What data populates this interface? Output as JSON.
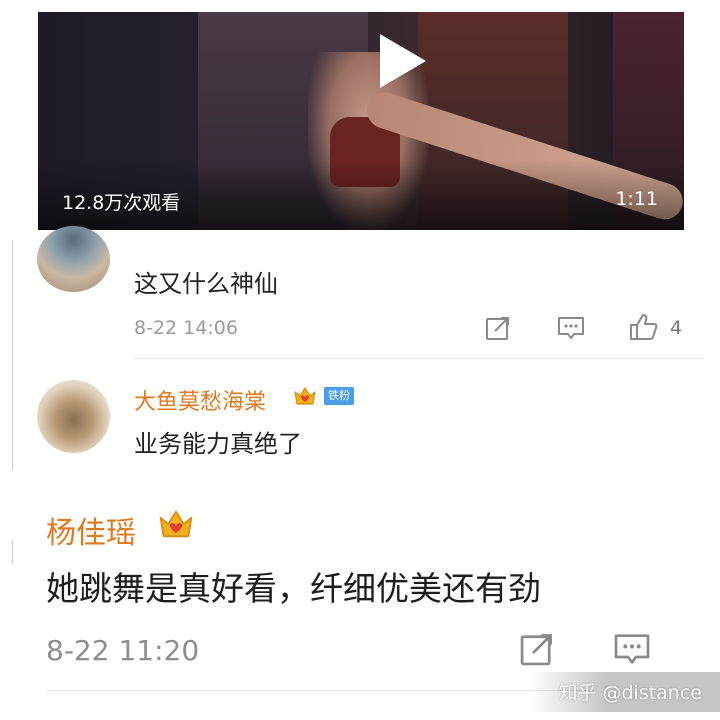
{
  "video": {
    "views": "12.8万次观看",
    "duration": "1:11"
  },
  "comments": [
    {
      "text": "这又什么神仙",
      "time": "8-22 14:06",
      "likes": "4"
    },
    {
      "name": "大鱼莫愁海棠",
      "tag": "铁粉",
      "text": "业务能力真绝了"
    },
    {
      "name": "杨佳瑶",
      "text": "她跳舞是真好看，纤细优美还有劲",
      "time": "8-22 11:20"
    }
  ],
  "watermark": "知乎 @distance",
  "colors": {
    "name_orange": "#e07a1f",
    "meta_gray": "#9a9a9a",
    "tag_blue": "#4a9ee8"
  },
  "icons": [
    "play-icon",
    "share-icon",
    "comment-icon",
    "like-icon",
    "crown-badge-icon"
  ]
}
